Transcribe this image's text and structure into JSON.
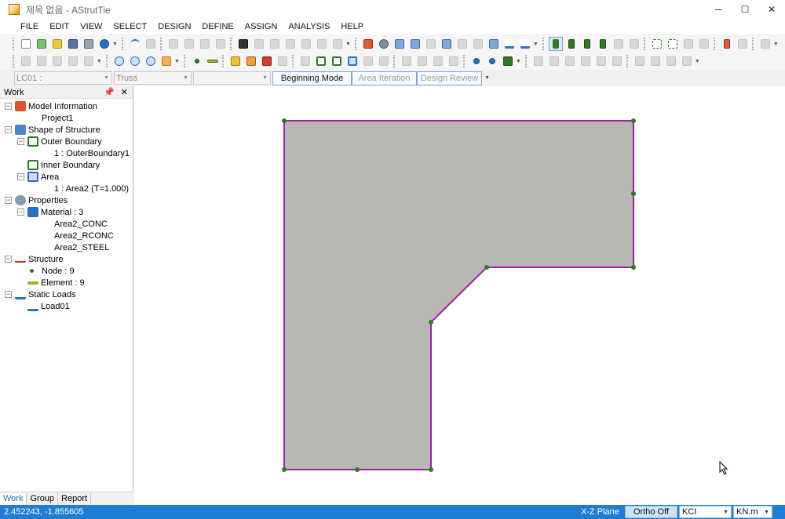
{
  "window": {
    "title": "제목 없음 - AStrutTie"
  },
  "menu": [
    "FILE",
    "EDIT",
    "VIEW",
    "SELECT",
    "DESIGN",
    "DEFINE",
    "ASSIGN",
    "ANALYSIS",
    "HELP"
  ],
  "selectors": {
    "load_case": "LC01 :",
    "model_type": "Truss",
    "third": ""
  },
  "modes": [
    "Beginning Mode",
    "Area Iteration",
    "Design Review"
  ],
  "panel": {
    "title": "Work",
    "tree": {
      "model_information": "Model Information",
      "project": "Project1",
      "shape_of_structure": "Shape of Structure",
      "outer_boundary": "Outer Boundary",
      "outer_boundary_item": "1 : OuterBoundary1",
      "inner_boundary": "Inner Boundary",
      "area": "Area",
      "area_item": "1 : Area2 (T=1.000)",
      "properties": "Properties",
      "material": "Material : 3",
      "material_items": [
        "Area2_CONC",
        "Area2_RCONC",
        "Area2_STEEL"
      ],
      "structure": "Structure",
      "node": "Node : 9",
      "element": "Element : 9",
      "static_loads": "Static Loads",
      "load": "Load01"
    },
    "tabs": [
      "Work",
      "Group",
      "Report"
    ]
  },
  "status": {
    "coords": "2.452243, -1.855605",
    "plane": "X-Z Plane",
    "ortho": "Ortho Off",
    "code": "KCI",
    "unit": "KN.m"
  },
  "colors": {
    "shape_fill": "#b7b7b3",
    "boundary": "#a020a8",
    "node": "#2e7a20",
    "status_bg": "#1e7ed4"
  }
}
